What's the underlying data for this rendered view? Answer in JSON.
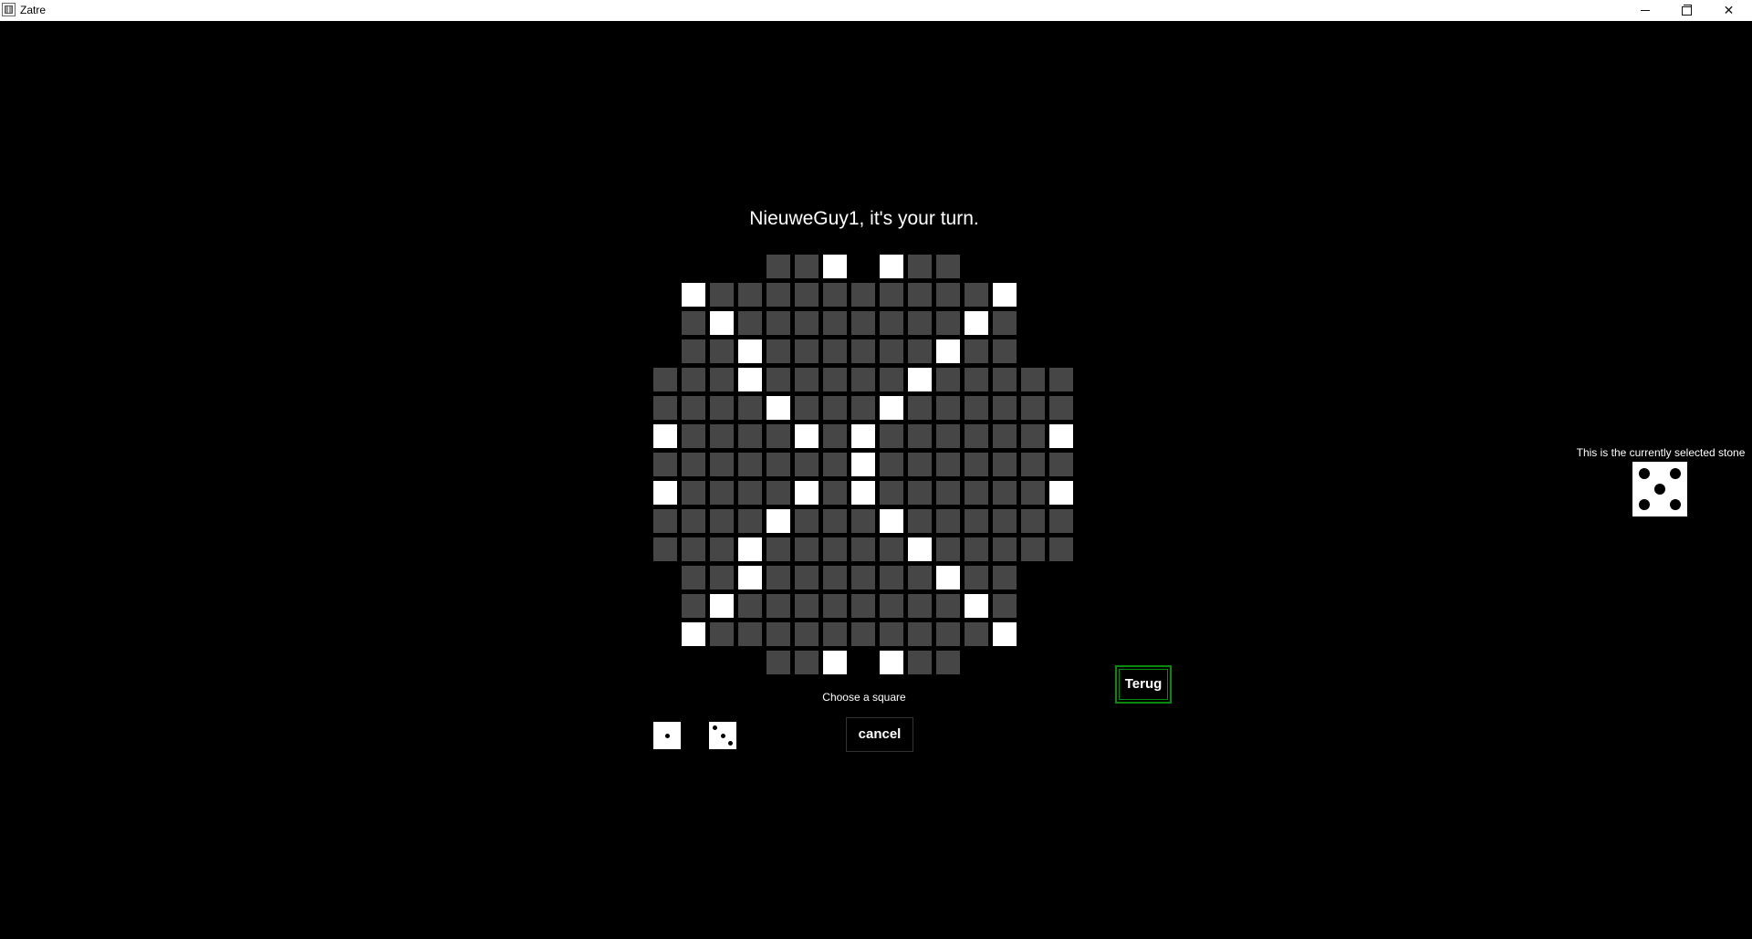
{
  "window": {
    "title": "Zatre",
    "icon": "app-icon"
  },
  "game": {
    "turn_message": "NieuweGuy1, it's your turn.",
    "instruction": "Choose a square",
    "cancel_label": "cancel",
    "back_label": "Terug",
    "selected_stone_label": "This is the currently selected stone",
    "selected_stone_value": 5,
    "hand_stones": [
      1,
      3
    ]
  },
  "board": {
    "rows": [
      "    ..W W..    ",
      " W..........W  ",
      " .W........W.  ",
      " ..W......W..  ",
      "...W.....W.....",
      "....W...W......",
      "W....W.W......W",
      ".......W.......",
      "W....W.W......W",
      "....W...W......",
      "...W.....W.....",
      " ..W......W..  ",
      " .W........W.  ",
      " W..........W  ",
      "    ..W W..    "
    ],
    "legend": {
      "W": "white-square",
      ".": "dark-square",
      " ": "no-square"
    }
  },
  "colors": {
    "background": "#000000",
    "dark_square": "#464646",
    "white_square": "#ffffff",
    "back_button_border": "#0a8a0a"
  }
}
